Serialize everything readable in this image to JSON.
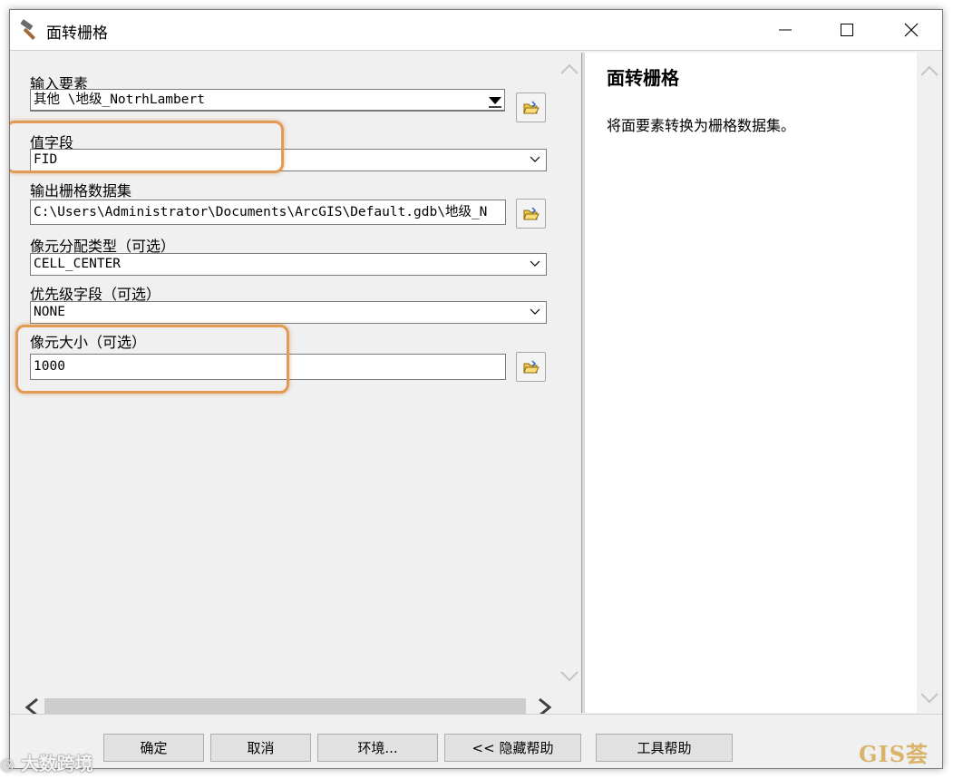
{
  "window": {
    "title": "面转栅格"
  },
  "params": {
    "input_features": {
      "label": "输入要素",
      "value": "其他 \\地级_NotrhLambert"
    },
    "value_field": {
      "label": "值字段",
      "value": "FID"
    },
    "output_raster": {
      "label": "输出栅格数据集",
      "value": "C:\\Users\\Administrator\\Documents\\ArcGIS\\Default.gdb\\地级_N"
    },
    "cell_assignment": {
      "label": "像元分配类型（可选）",
      "value": "CELL_CENTER"
    },
    "priority_field": {
      "label": "优先级字段（可选）",
      "value": "NONE"
    },
    "cell_size": {
      "label": "像元大小（可选）",
      "value": "1000"
    }
  },
  "help": {
    "title": "面转栅格",
    "description": "将面要素转换为栅格数据集。"
  },
  "buttons": {
    "ok": "确定",
    "cancel": "取消",
    "environments": "环境...",
    "hide_help": "<< 隐藏帮助",
    "tool_help": "工具帮助"
  },
  "watermarks": {
    "right": "GIS荟",
    "left": "大数跨境"
  },
  "colors": {
    "highlight": "#e29a55",
    "window_bg": "#f0f0f0",
    "help_bg": "#ffffff"
  }
}
